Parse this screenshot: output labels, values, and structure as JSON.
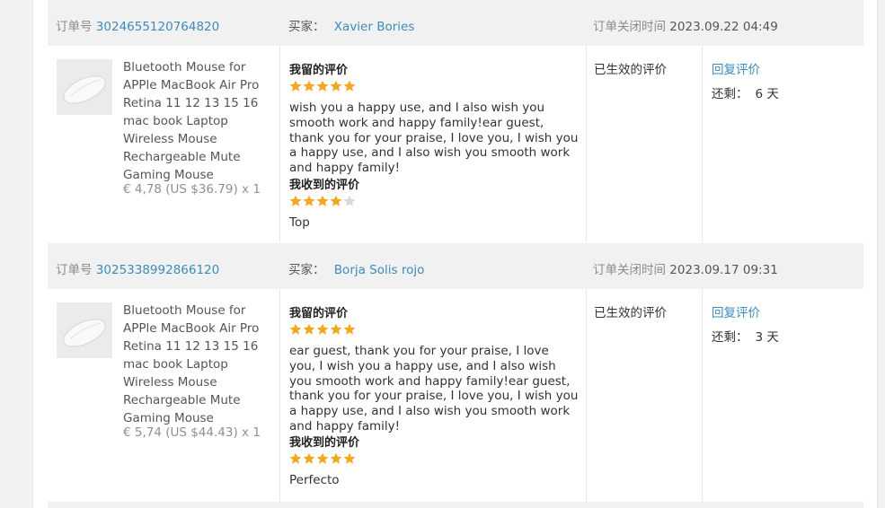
{
  "colors": {
    "accent_link": "#3d8bb8",
    "star_filled": "#f5a623",
    "star_empty": "#d8d8d8",
    "header_bg": "#f1f1f1"
  },
  "labels": {
    "order_no": "订单号",
    "buyer": "买家：",
    "close_time": "订单关闭时间",
    "my_review": "我留的评价",
    "received_review": "我收到的评价",
    "status": "已生效的评价",
    "reply": "回复评价",
    "remaining": "还剩：",
    "days_unit": "天"
  },
  "orders": [
    {
      "order_id": "3024655120764820",
      "buyer": "Xavier Bories",
      "close_time": "2023.09.22 04:49",
      "product_title": "Bluetooth Mouse for APPle MacBook Air Pro Retina 11 12 13 15 16 mac book Laptop Wireless Mouse Rechargeable Mute Gaming Mouse",
      "price": "€ 4,78 (US $36.79) x 1",
      "my_stars": 5,
      "my_review": "wish you a happy use, and I also wish you smooth work and happy family!ear guest, thank you for your praise, I love you, I wish you a happy use, and I also wish you smooth work and happy family!",
      "received_stars": 4,
      "received_review": "Top",
      "days_left": "6"
    },
    {
      "order_id": "3025338992866120",
      "buyer": "Borja Solis rojo",
      "close_time": "2023.09.17 09:31",
      "product_title": "Bluetooth Mouse for APPle MacBook Air Pro Retina 11 12 13 15 16 mac book Laptop Wireless Mouse Rechargeable Mute Gaming Mouse",
      "price": "€ 5,74 (US $44.43) x 1",
      "my_stars": 5,
      "my_review": "ear guest, thank you for your praise, I love you, I wish you a happy use, and I also wish you smooth work and happy family!ear guest, thank you for your praise, I love you, I wish you a happy use, and I also wish you smooth work and happy family!",
      "received_stars": 5,
      "received_review": "Perfecto",
      "days_left": "3"
    }
  ]
}
